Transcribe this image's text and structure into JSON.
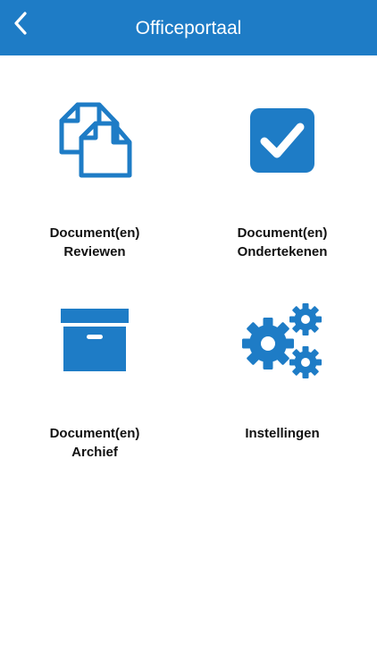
{
  "header": {
    "title": "Officeportaal",
    "back_icon": "chevron-left-icon"
  },
  "colors": {
    "header_bg": "#1e7cc6",
    "icon": "#1e7cc6"
  },
  "tiles": [
    {
      "line1": "Document(en)",
      "line2": "Reviewen",
      "icon": "documents-icon"
    },
    {
      "line1": "Document(en)",
      "line2": "Ondertekenen",
      "icon": "checkbox-icon"
    },
    {
      "line1": "Document(en)",
      "line2": "Archief",
      "icon": "archive-box-icon"
    },
    {
      "line1": "Instellingen",
      "line2": "",
      "icon": "gears-icon"
    }
  ]
}
